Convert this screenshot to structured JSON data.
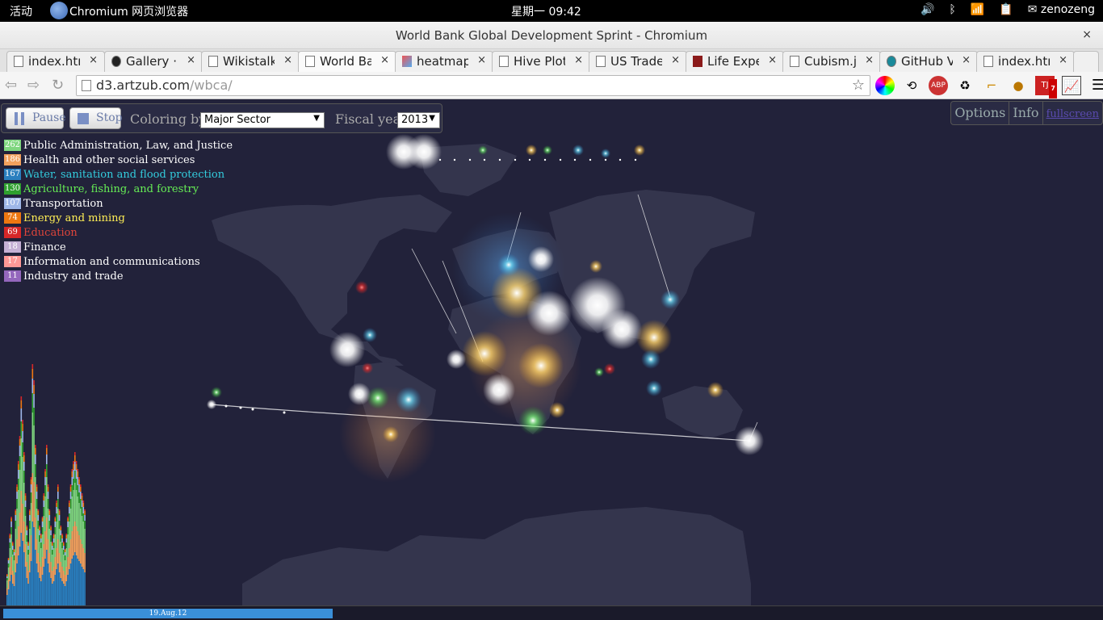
{
  "topbar": {
    "activities": "活动",
    "app_name": "Chromium 网页浏览器",
    "clock": "星期一 09:42",
    "user": "zenozeng",
    "user_icon": "✉"
  },
  "window": {
    "title": "World Bank Global Development Sprint - Chromium",
    "close": "×"
  },
  "tabs": [
    {
      "label": "index.htr",
      "close": "×"
    },
    {
      "label": "Gallery ·",
      "close": "×"
    },
    {
      "label": "Wikistalk",
      "close": "×"
    },
    {
      "label": "World Bar",
      "close": "×"
    },
    {
      "label": "heatmap",
      "close": "×"
    },
    {
      "label": "Hive Plot",
      "close": "×"
    },
    {
      "label": "US Trade",
      "close": "×"
    },
    {
      "label": "Life Expe",
      "close": "×"
    },
    {
      "label": "Cubism.js",
      "close": "×"
    },
    {
      "label": "GitHub V",
      "close": "×"
    },
    {
      "label": "index.htr",
      "close": "×"
    }
  ],
  "omnibox": {
    "host": "d3.artzub.com",
    "path": "/wbca/"
  },
  "extensions": {
    "abp": "ABP",
    "badge": "7"
  },
  "controls": {
    "pause_label": "Pause",
    "stop_label": "Stop",
    "coloring_label": "Coloring by:",
    "coloring_value": "Major Sector",
    "fiscal_label": "Fiscal year:",
    "fiscal_value": "2013"
  },
  "topright": {
    "options": "Options",
    "info": "Info",
    "fullscreen": "fullscreen"
  },
  "legend": [
    {
      "count": "262",
      "label": "Public Administration, Law, and Justice",
      "color": "#7fd67f",
      "text": "#ffffff"
    },
    {
      "count": "186",
      "label": "Health and other social services",
      "color": "#f3a15d",
      "text": "#ffffff"
    },
    {
      "count": "167",
      "label": "Water, sanitation and flood protection",
      "color": "#2a7fbf",
      "text": "#33ccdd"
    },
    {
      "count": "130",
      "label": "Agriculture, fishing, and forestry",
      "color": "#2fa02f",
      "text": "#66ee55"
    },
    {
      "count": "107",
      "label": "Transportation",
      "color": "#9fb7e8",
      "text": "#ffffff"
    },
    {
      "count": "74",
      "label": "Energy and mining",
      "color": "#ee7711",
      "text": "#ffee55"
    },
    {
      "count": "69",
      "label": "Education",
      "color": "#d62728",
      "text": "#e0453a"
    },
    {
      "count": "18",
      "label": "Finance",
      "color": "#c5b0d5",
      "text": "#ffffff"
    },
    {
      "count": "17",
      "label": "Information and communications",
      "color": "#ff9896",
      "text": "#ffffff"
    },
    {
      "count": "11",
      "label": "Industry and trade",
      "color": "#9467bd",
      "text": "#ffffff"
    }
  ],
  "timeline": {
    "date": "19.Aug.12"
  }
}
